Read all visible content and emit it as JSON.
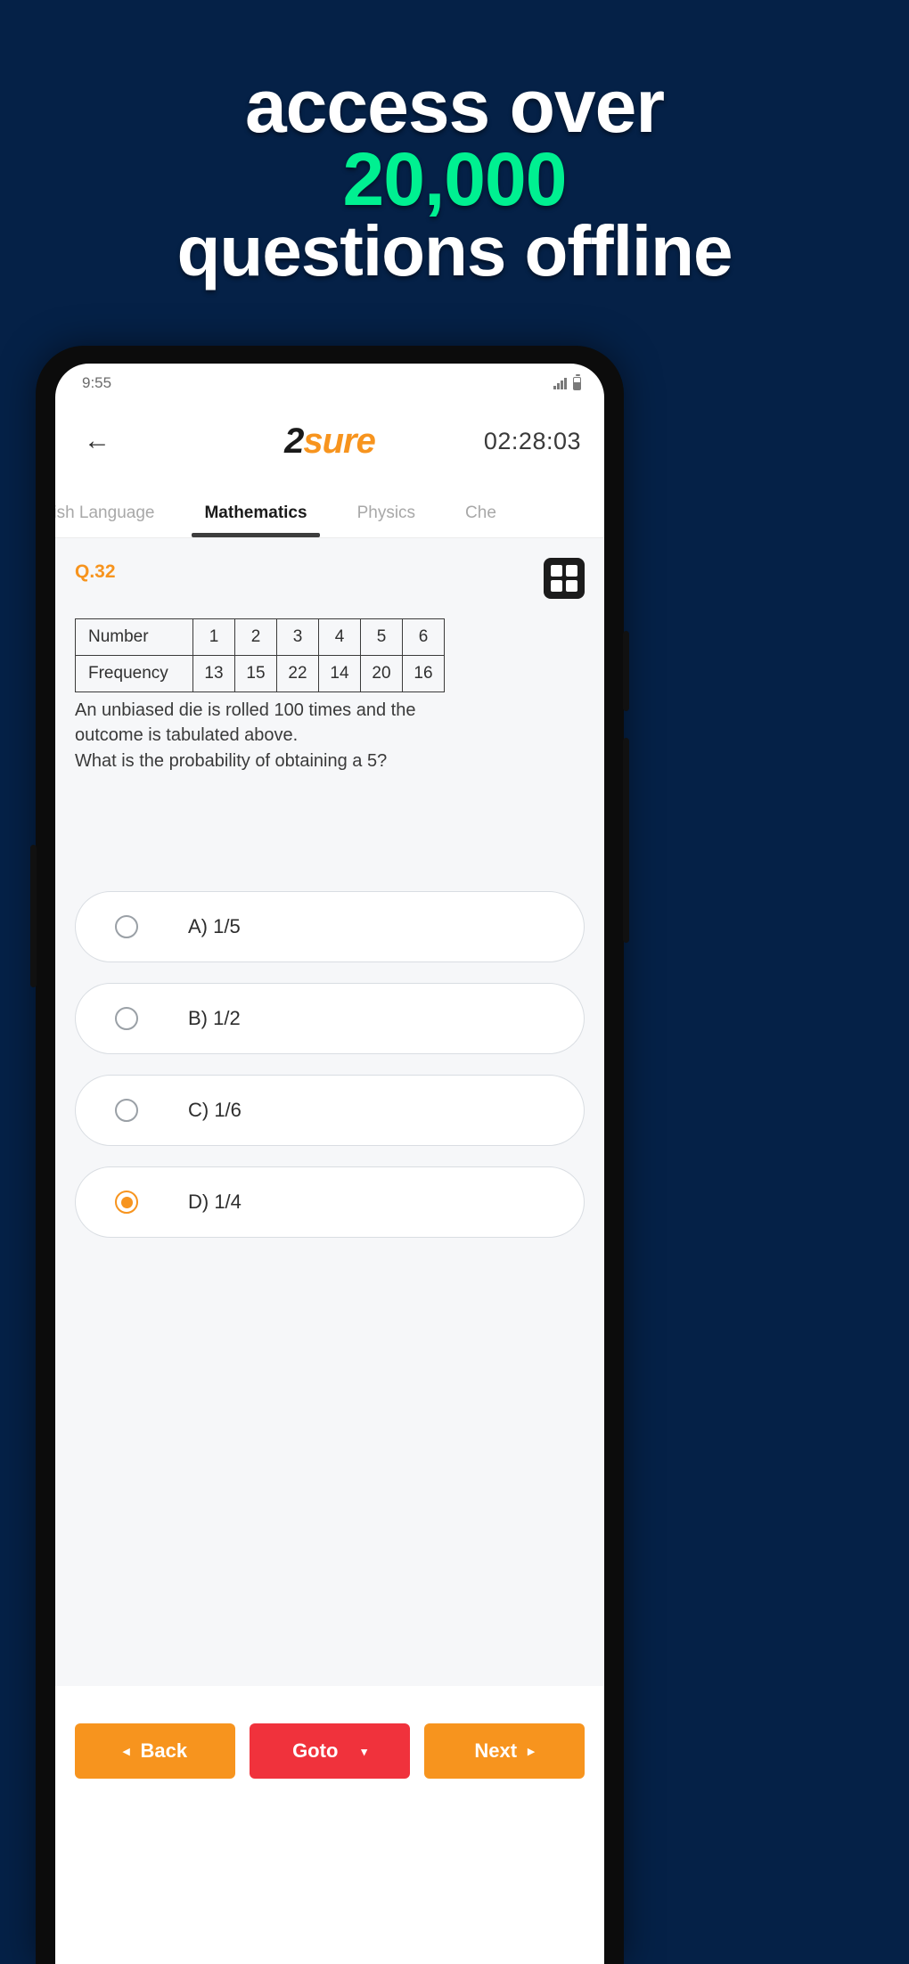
{
  "promo": {
    "line1": "access over",
    "line2": "20,000",
    "line3": "questions offline",
    "text_color": "#ffffff",
    "accent_color": "#00f091",
    "background_color": "#052147"
  },
  "phone": {
    "status_bar": {
      "time": "9:55",
      "signal_icon": "signal-bars-icon",
      "battery_icon": "battery-icon"
    },
    "app_bar": {
      "back_icon": "back-arrow-icon",
      "logo_prefix": "2",
      "logo_suffix": "sure",
      "logo_accent_color": "#f7941e",
      "timer": "02:28:03"
    },
    "tabs": [
      {
        "label": "nglish Language",
        "active": false
      },
      {
        "label": "Mathematics",
        "active": true
      },
      {
        "label": "Physics",
        "active": false
      },
      {
        "label": "Che",
        "active": false
      }
    ],
    "question": {
      "number_label": "Q.32",
      "number_color": "#f7941e",
      "grid_icon": "calculator-grid-icon",
      "table": {
        "rows": [
          {
            "header": "Number",
            "cells": [
              "1",
              "2",
              "3",
              "4",
              "5",
              "6"
            ]
          },
          {
            "header": "Frequency",
            "cells": [
              "13",
              "15",
              "22",
              "14",
              "20",
              "16"
            ]
          }
        ]
      },
      "text_line_1": "An unbiased die is rolled 100 times and the",
      "text_line_2": "outcome is tabulated above.",
      "text_line_3": "What is the probability of obtaining a 5?",
      "options": [
        {
          "label": "A) 1/5",
          "selected": false
        },
        {
          "label": "B) 1/2",
          "selected": false
        },
        {
          "label": "C) 1/6",
          "selected": false
        },
        {
          "label": "D) 1/4",
          "selected": true
        }
      ]
    },
    "bottom_bar": {
      "back_label": "Back",
      "back_arrow": "◂",
      "goto_label": "Goto",
      "goto_caret": "▾",
      "next_label": "Next",
      "next_arrow": "▸",
      "back_color": "#f7941e",
      "goto_color": "#f0323c",
      "next_color": "#f7941e"
    }
  }
}
